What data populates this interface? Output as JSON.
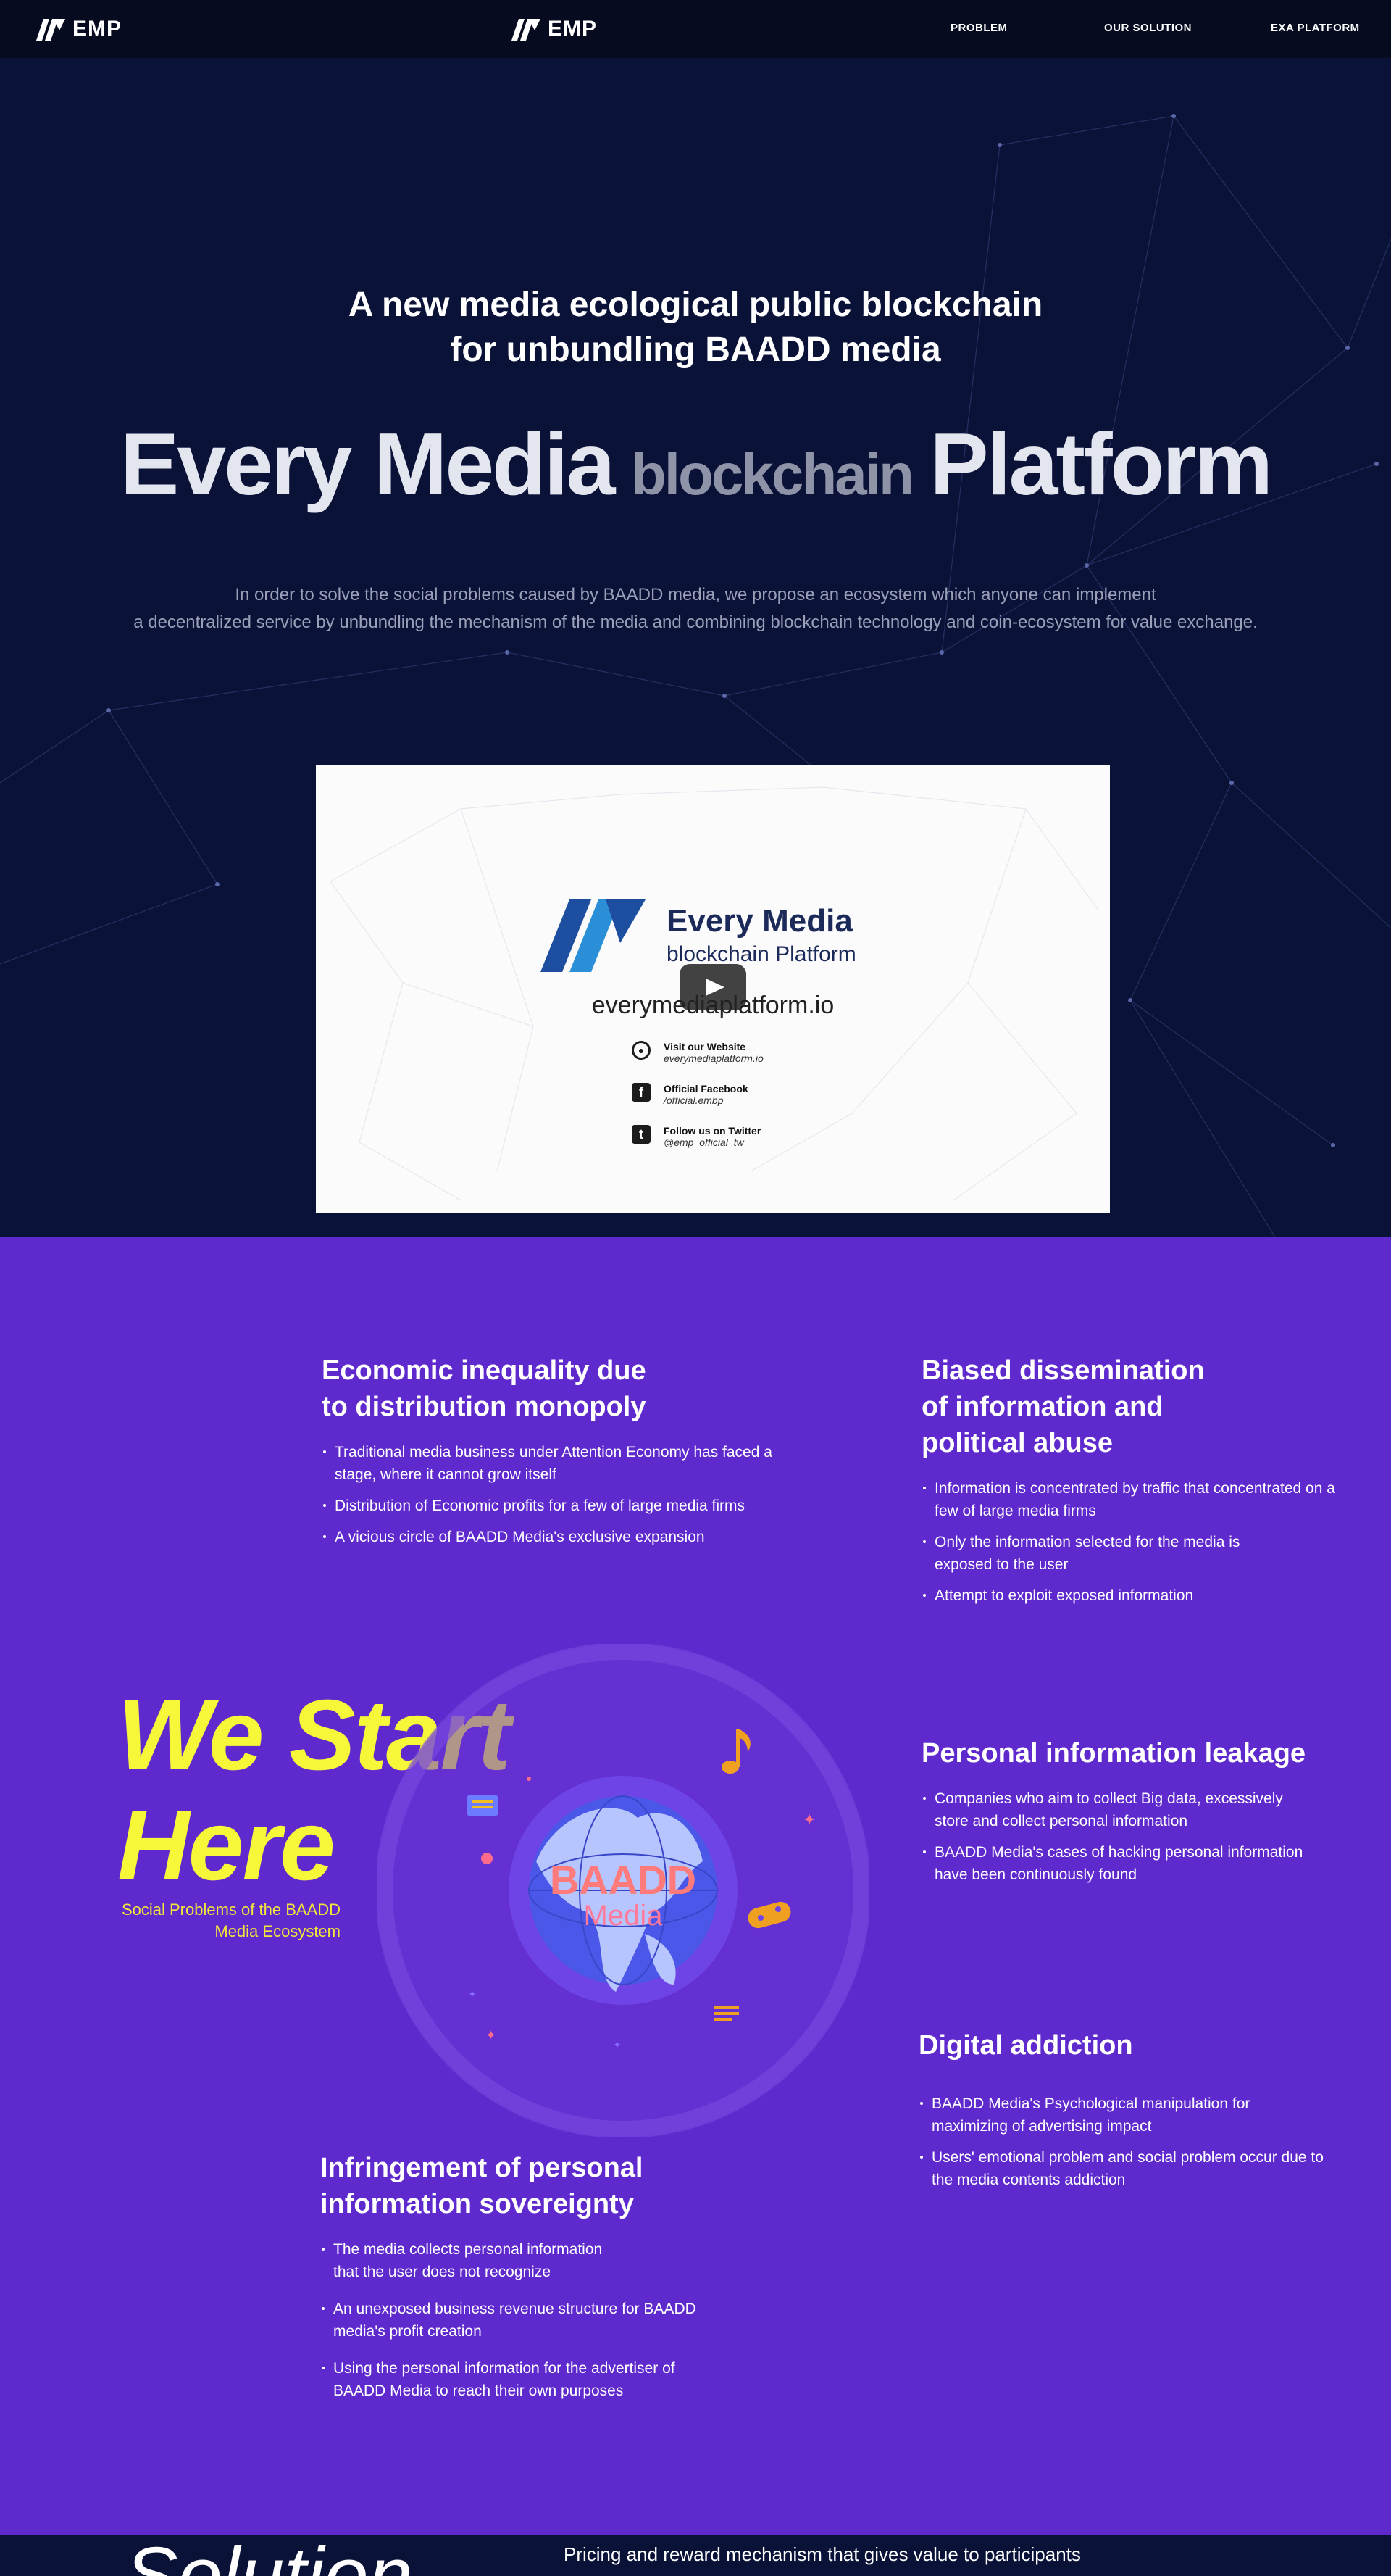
{
  "header": {
    "logo_text": "EMP",
    "nav": [
      "PROBLEM",
      "OUR SOLUTION",
      "EXA PLATFORM"
    ]
  },
  "hero": {
    "headline_line1": "A new media ecological public blockchain",
    "headline_line2": "for unbundling BAADD media",
    "brand": {
      "word1": "Every",
      "word2": "Media",
      "word3": "blockchain",
      "word4": "Platform"
    },
    "desc_line1": "In order to solve the social problems caused by BAADD media, we propose an ecosystem which anyone can implement",
    "desc_line2": "a decentralized service by unbundling the mechanism of the media and combining blockchain technology and coin-ecosystem for value exchange."
  },
  "video": {
    "title": "Every Media",
    "subtitle": "blockchain Platform",
    "url": "everymediaplatform.io",
    "links": [
      {
        "icon": "globe-icon",
        "label": "Visit our Website",
        "value": "everymediaplatform.io"
      },
      {
        "icon": "facebook-icon",
        "label": "Official Facebook",
        "value": "/official.embp"
      },
      {
        "icon": "twitter-icon",
        "label": "Follow us on Twitter",
        "value": "@emp_official_tw"
      }
    ]
  },
  "problems": {
    "cards": [
      {
        "title": [
          "Economic inequality due",
          "to distribution monopoly"
        ],
        "items": [
          "Traditional media business under Attention Economy has faced a stage, where it cannot grow itself",
          "Distribution of Economic profits for a few of large media firms",
          "A vicious circle of BAADD Media's exclusive expansion"
        ]
      },
      {
        "title": [
          "Biased dissemination",
          "of information and",
          "political abuse"
        ],
        "items": [
          "Information is concentrated by traffic that concentrated on a few of large media firms",
          "Only the information selected for the media is exposed to the user",
          "Attempt to exploit exposed information"
        ]
      },
      {
        "title": [
          "Personal information leakage"
        ],
        "items": [
          "Companies who aim to collect Big data, excessively store and collect personal information",
          "BAADD Media's cases of hacking personal information have been continuously found"
        ]
      },
      {
        "title": [
          "Digital addiction"
        ],
        "items": [
          "BAADD Media's Psychological manipulation for maximizing of advertising impact",
          "Users' emotional problem and social problem occur due to the media contents addiction"
        ]
      },
      {
        "title": [
          "Infringement of personal",
          "information sovereignty"
        ],
        "items": [
          "The media collects personal information that the user does not recognize",
          "An unexposed business revenue structure for BAADD media's profit creation",
          "Using the personal information for the advertiser of BAADD Media to reach their own purposes"
        ]
      }
    ],
    "start_line1": "We Start",
    "start_line2": "Here",
    "start_sub": "Social Problems of the BAADD Media Ecosystem",
    "globe_text1": "BAADD",
    "globe_text2": "Media"
  },
  "solution": {
    "title": "Solution",
    "subtitle": "Pricing and reward mechanism that gives value to participants"
  },
  "colors": {
    "hero_bg": "#0b1238",
    "purple": "#5f2acd",
    "yellow": "#f7f73a"
  }
}
